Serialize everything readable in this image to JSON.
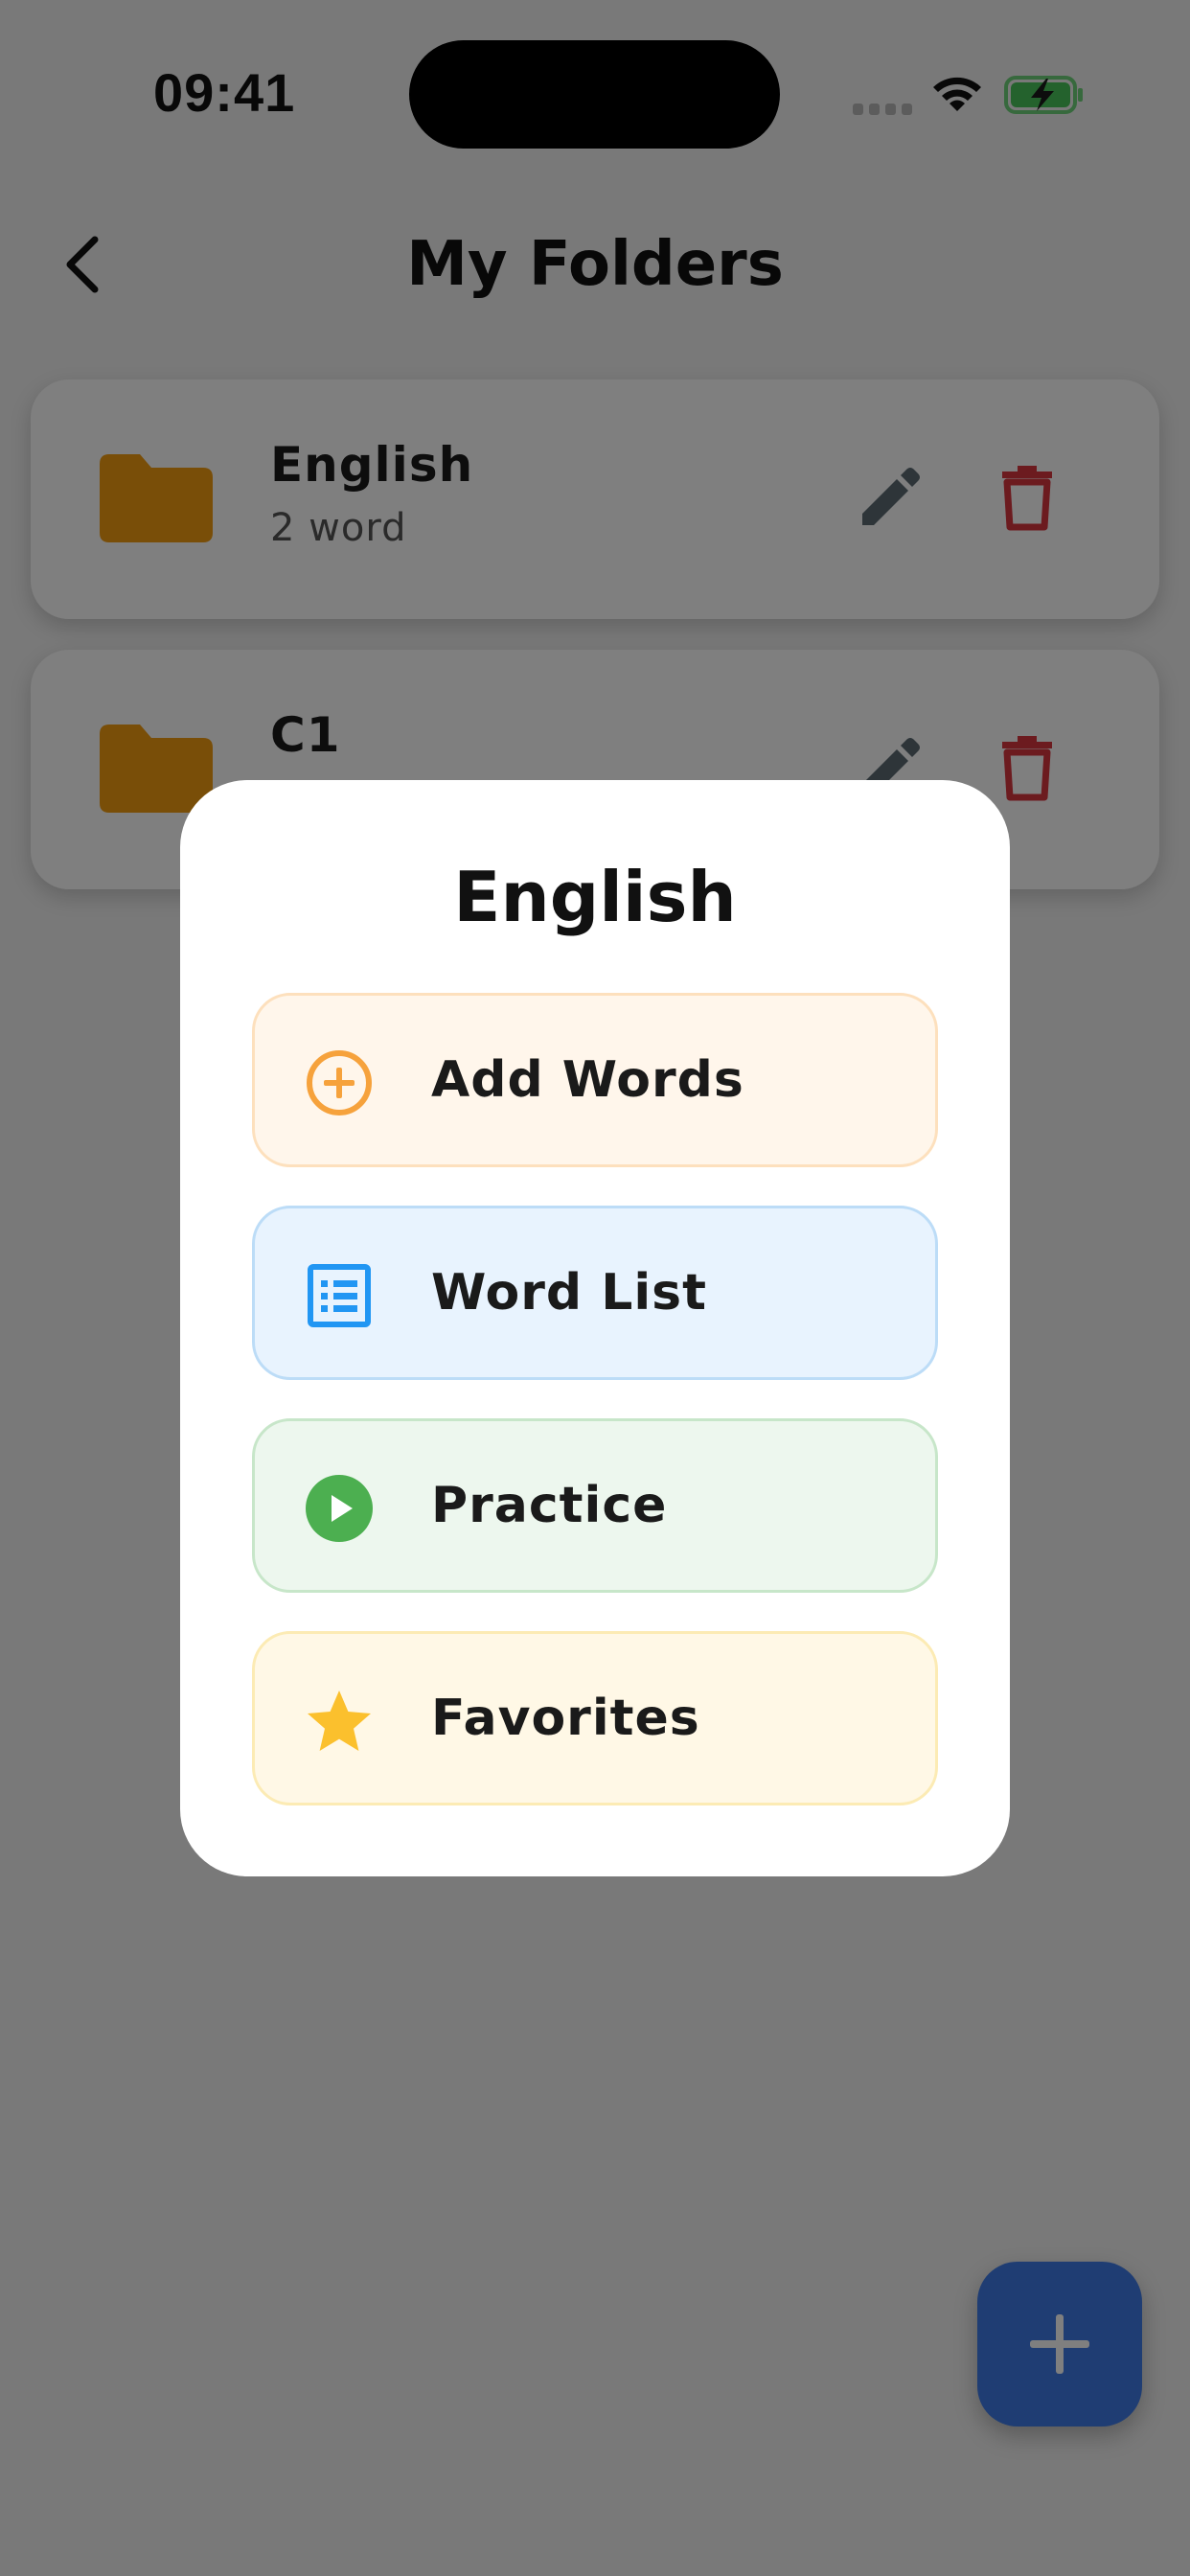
{
  "status_bar": {
    "time": "09:41"
  },
  "header": {
    "title": "My Folders",
    "back_icon": "chevron-left-icon"
  },
  "folders": [
    {
      "name": "English",
      "count": "2 word",
      "icon": "folder-icon"
    },
    {
      "name": "C1",
      "count": "",
      "icon": "folder-icon"
    }
  ],
  "dialog": {
    "title": "English",
    "options": [
      {
        "label": "Add Words",
        "icon": "plus-circle-icon",
        "color": "#f6a23c"
      },
      {
        "label": "Word List",
        "icon": "list-icon",
        "color": "#2196f3"
      },
      {
        "label": "Practice",
        "icon": "play-circle-icon",
        "color": "#4caf50"
      },
      {
        "label": "Favorites",
        "icon": "star-icon",
        "color": "#fbc02d"
      }
    ]
  },
  "colors": {
    "folder": "#f29c11",
    "edit": "#5c6b73",
    "delete": "#d9363e",
    "fab": "#3f7be6",
    "overlay": "rgba(0,0,0,0.5)"
  }
}
